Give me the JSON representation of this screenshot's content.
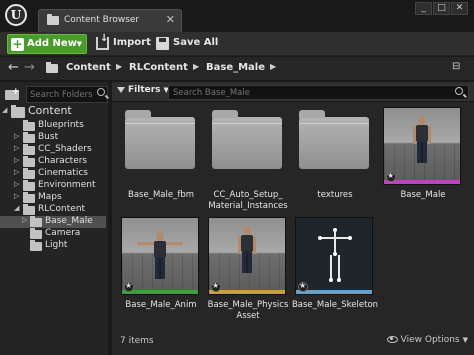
{
  "window": {
    "tab_title": "Content Browser",
    "close_glyph": "✕",
    "window_buttons": [
      "_",
      "□",
      "✕"
    ]
  },
  "toolbar": {
    "add_new_label": "Add New",
    "import_label": "Import",
    "save_all_label": "Save All"
  },
  "path": {
    "crumbs": [
      "Content",
      "RLContent",
      "Base_Male"
    ]
  },
  "folders_panel": {
    "search_placeholder": "Search Folders",
    "tree": [
      {
        "label": "Content",
        "root": true,
        "expanded": true
      },
      {
        "label": "Blueprints"
      },
      {
        "label": "Bust"
      },
      {
        "label": "CC_Shaders"
      },
      {
        "label": "Characters"
      },
      {
        "label": "Cinematics"
      },
      {
        "label": "Environment"
      },
      {
        "label": "Maps"
      },
      {
        "label": "RLContent",
        "expanded": true
      },
      {
        "label": "Base_Male",
        "selected": true
      },
      {
        "label": "Camera"
      },
      {
        "label": "Light"
      }
    ]
  },
  "assets_panel": {
    "filters_label": "Filters",
    "search_placeholder": "Search Base_Male",
    "items": [
      {
        "name": "Base_Male_fbm",
        "kind": "folder"
      },
      {
        "name": "CC_Auto_Setup_ Material_Instances",
        "kind": "folder"
      },
      {
        "name": "textures",
        "kind": "folder"
      },
      {
        "name": "Base_Male",
        "kind": "skeletal-mesh",
        "type_color": "#c040c0"
      },
      {
        "name": "Base_Male_Anim",
        "kind": "animation",
        "type_color": "#3aa03a"
      },
      {
        "name": "Base_Male_Physics Asset",
        "kind": "physics-asset",
        "type_color": "#c8a040"
      },
      {
        "name": "Base_Male_Skeleton",
        "kind": "skeleton",
        "type_color": "#6aa0c8"
      }
    ],
    "item_count": "7 items",
    "view_options_label": "View Options"
  },
  "colors": {
    "add_new_green": "#4a9c2a",
    "background": "#262626"
  }
}
